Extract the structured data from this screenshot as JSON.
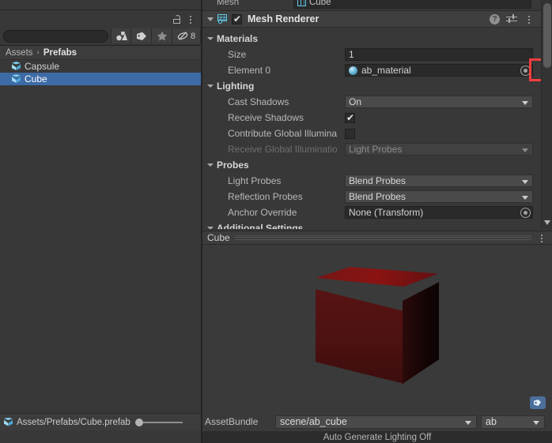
{
  "project_panel": {
    "lock_icon": "lock-open-icon",
    "menu_icon": "kebab-menu-icon",
    "search": {
      "value": "",
      "placeholder": ""
    },
    "filters": [
      {
        "name": "filter-by-type-icon",
        "label": ""
      },
      {
        "name": "filter-by-label-icon",
        "label": ""
      },
      {
        "name": "favorites-star-icon",
        "label": ""
      },
      {
        "name": "saved-search-icon",
        "label": "8"
      }
    ],
    "breadcrumb": {
      "root": "Assets",
      "separator": "›",
      "current": "Prefabs"
    },
    "items": [
      {
        "label": "Capsule",
        "selected": false
      },
      {
        "label": "Cube",
        "selected": true
      }
    ],
    "footer_path": "Assets/Prefabs/Cube.prefab"
  },
  "inspector": {
    "cut_row": {
      "label": "Mesh",
      "value": "Cube"
    },
    "component": {
      "title": "Mesh Renderer",
      "enabled_checkbox": true,
      "help_icon": "?",
      "preset_icon": "preset-settings-icon",
      "menu_icon": "kebab-menu-icon"
    },
    "materials": {
      "section_label": "Materials",
      "size_label": "Size",
      "size_value": "1",
      "element_label": "Element 0",
      "element_value": "ab_material",
      "highlight_color": "#f73d3d"
    },
    "lighting": {
      "section_label": "Lighting",
      "rows": [
        {
          "label": "Cast Shadows",
          "type": "popup",
          "value": "On",
          "dim": false
        },
        {
          "label": "Receive Shadows",
          "type": "checkbox",
          "checked": true,
          "dim": false
        },
        {
          "label": "Contribute Global Illumina",
          "type": "checkbox",
          "checked": false,
          "dim": false
        },
        {
          "label": "Receive Global Illuminatio",
          "type": "popup",
          "value": "Light Probes",
          "dim": true
        }
      ]
    },
    "probes": {
      "section_label": "Probes",
      "rows": [
        {
          "label": "Light Probes",
          "type": "popup",
          "value": "Blend Probes"
        },
        {
          "label": "Reflection Probes",
          "type": "popup",
          "value": "Blend Probes"
        },
        {
          "label": "Anchor Override",
          "type": "object",
          "value": "None (Transform)"
        }
      ]
    },
    "additional_settings": {
      "section_label": "Additional Settings"
    }
  },
  "preview": {
    "title": "Cube",
    "menu_icon": "kebab-menu-icon",
    "tag_icon": "asset-label-tag-icon",
    "object_color": "#8b1313"
  },
  "assetbundle": {
    "label": "AssetBundle",
    "name": "scene/ab_cube",
    "variant": "ab"
  },
  "statusbar": {
    "text": "Auto Generate Lighting Off"
  }
}
